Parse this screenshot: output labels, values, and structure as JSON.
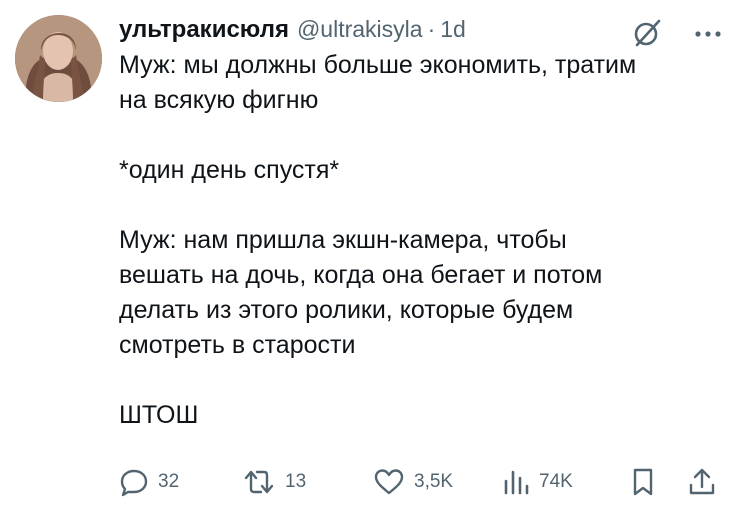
{
  "user": {
    "display_name": "ультракисюля",
    "handle": "@ultrakisyla",
    "separator": "·",
    "time": "1d"
  },
  "tweet": {
    "paragraphs": [
      "Муж: мы должны больше экономить, тратим\nна всякую фигню",
      "*один день спустя*",
      "Муж: нам пришла экшн-камера, чтобы\nвешать на дочь, когда она бегает и потом\nделать из этого ролики, которые будем\nсмотреть в старости",
      "ШТОШ"
    ]
  },
  "actions": {
    "reply_count": "32",
    "retweet_count": "13",
    "like_count": "3,5K",
    "views_count": "74K"
  },
  "icons": {
    "grok": "grok-icon",
    "more": "more-icon",
    "reply": "reply-icon",
    "retweet": "retweet-icon",
    "like": "heart-icon",
    "views": "views-icon",
    "bookmark": "bookmark-icon",
    "share": "share-icon"
  },
  "colors": {
    "text": "#0f1419",
    "secondary": "#536471",
    "background": "#ffffff"
  }
}
